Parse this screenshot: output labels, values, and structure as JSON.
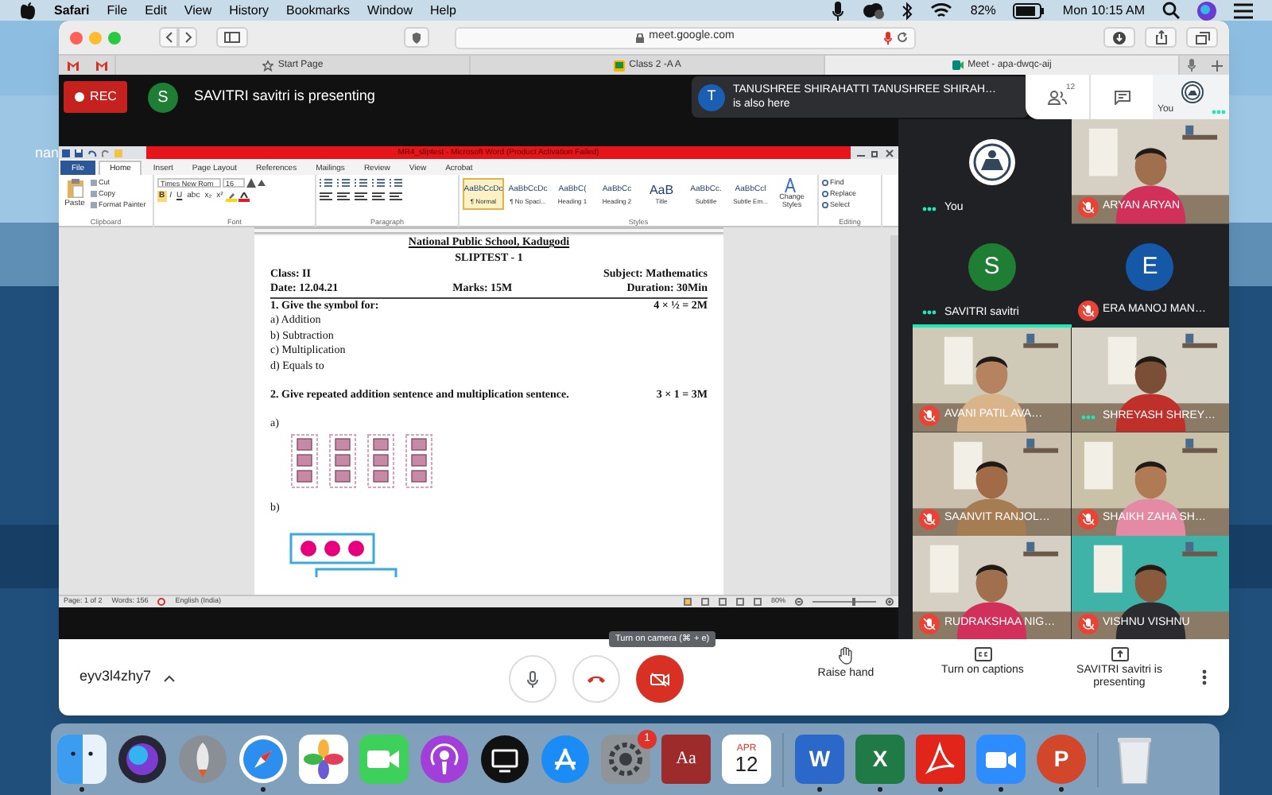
{
  "menubar": {
    "app": "Safari",
    "menus": [
      "File",
      "Edit",
      "View",
      "History",
      "Bookmarks",
      "Window",
      "Help"
    ],
    "battery": "82%",
    "clock": "Mon 10:15 AM"
  },
  "desktop_label": "nan",
  "browser": {
    "address": "meet.google.com",
    "tabs": [
      {
        "label": "Start Page",
        "kind": "start",
        "selected": false
      },
      {
        "label": "Class 2 -A A",
        "kind": "classroom",
        "selected": false
      },
      {
        "label": "Meet - apa-dwqc-aij",
        "kind": "meet",
        "selected": true
      }
    ]
  },
  "meet": {
    "rec": "REC",
    "presenter": {
      "initial": "S",
      "color": "#1e7e34",
      "text": "SAVITRI savitri is presenting"
    },
    "notice": {
      "initial": "T",
      "color": "#1a5fb4",
      "name": "TANUSHREE SHIRAHATTI TANUSHREE SHIRAH…",
      "text": "is also here"
    },
    "people_count": "12",
    "self_label": "You",
    "word": {
      "title": "MR4_sliptest - Microsoft Word (Product Activation Failed)",
      "tabs": [
        {
          "label": "File",
          "kind": "file",
          "selected": false
        },
        {
          "label": "Home",
          "kind": "tab",
          "selected": true
        },
        {
          "label": "Insert",
          "kind": "tab",
          "selected": false
        },
        {
          "label": "Page Layout",
          "kind": "tab",
          "selected": false
        },
        {
          "label": "References",
          "kind": "tab",
          "selected": false
        },
        {
          "label": "Mailings",
          "kind": "tab",
          "selected": false
        },
        {
          "label": "Review",
          "kind": "tab",
          "selected": false
        },
        {
          "label": "View",
          "kind": "tab",
          "selected": false
        },
        {
          "label": "Acrobat",
          "kind": "tab",
          "selected": false
        }
      ],
      "paste": "Paste",
      "clipboard": [
        "Cut",
        "Copy",
        "Format Painter"
      ],
      "font_name": "Times New Rom",
      "font_size": "16",
      "font_buttons": [
        "B",
        "I",
        "U",
        "abc",
        "x₂",
        "x²"
      ],
      "styles": [
        {
          "sample": "AaBbCcDc",
          "label": "¶ Normal",
          "selected": true
        },
        {
          "sample": "AaBbCcDc",
          "label": "¶ No Spaci...",
          "selected": false
        },
        {
          "sample": "AaBbC(",
          "label": "Heading 1",
          "selected": false
        },
        {
          "sample": "AaBbCc",
          "label": "Heading 2",
          "selected": false
        },
        {
          "sample": "AaB",
          "label": "Title",
          "selected": false
        },
        {
          "sample": "AaBbCc.",
          "label": "Subtitle",
          "selected": false
        },
        {
          "sample": "AaBbCcl",
          "label": "Subtle Em...",
          "selected": false
        }
      ],
      "change_styles": "Change Styles",
      "editing": [
        "Find",
        "Replace",
        "Select"
      ],
      "groups": [
        "Clipboard",
        "Font",
        "Paragraph",
        "Styles",
        "Editing"
      ],
      "document": {
        "school": "National Public School, Kadugodi",
        "title": "SLIPTEST - 1",
        "header": [
          {
            "left": "Class: II",
            "right": "Subject: Mathematics"
          },
          {
            "left": "Date: 12.04.21",
            "middle": "Marks: 15M",
            "right": "Duration: 30Min"
          }
        ],
        "questions": [
          {
            "text": "1. Give the symbol for:",
            "marks": "4 × ½ = 2M",
            "options": [
              "a) Addition",
              "b) Subtraction",
              "c) Multiplication",
              "d) Equals to"
            ]
          },
          {
            "text": "2. Give repeated addition sentence and multiplication sentence.",
            "marks": "3 × 1 = 3M",
            "parts": [
              {
                "label": "a)",
                "kind": "squares"
              },
              {
                "label": "b)",
                "kind": "circles"
              }
            ]
          }
        ]
      },
      "status": {
        "page": "Page: 1 of 2",
        "words": "Words: 156",
        "language": "English (India)",
        "zoom": "80%",
        "zoom_slider": {
          "level": 0.65
        }
      }
    },
    "participants": [
      {
        "name": "You",
        "kind": "logo",
        "muted": false,
        "speaking": true,
        "active": false
      },
      {
        "name": "ARYAN ARYAN",
        "kind": "video",
        "muted": true,
        "speaking": false,
        "active": false
      },
      {
        "name": "SAVITRI savitri",
        "kind": "avatar",
        "initial": "S",
        "color": "#1e7e34",
        "muted": false,
        "speaking": true,
        "active": true
      },
      {
        "name": "ERA MANOJ MAN…",
        "kind": "avatar",
        "initial": "E",
        "color": "#1558a8",
        "muted": true,
        "speaking": false,
        "active": false
      },
      {
        "name": "AVANI PATIL AVA…",
        "kind": "video",
        "muted": true,
        "speaking": false,
        "active": false
      },
      {
        "name": "SHREYASH SHREY…",
        "kind": "video",
        "muted": false,
        "speaking": true,
        "active": false
      },
      {
        "name": "SAANVIT RANJOL…",
        "kind": "video",
        "muted": true,
        "speaking": false,
        "active": false
      },
      {
        "name": "SHAIKH ZAHA SH…",
        "kind": "video",
        "muted": true,
        "speaking": false,
        "active": false
      },
      {
        "name": "RUDRAKSHAA NIG…",
        "kind": "video",
        "muted": true,
        "speaking": false,
        "active": false
      },
      {
        "name": "VISHNU VISHNU",
        "kind": "video",
        "muted": true,
        "speaking": false,
        "active": false
      }
    ],
    "meeting_code": "eyv3l4zhy7",
    "tooltip": "Turn on camera (⌘ + e)",
    "mic_on": true,
    "camera_on": false,
    "actions": [
      {
        "label": "Raise hand",
        "kind": "hand"
      },
      {
        "label": "Turn on captions",
        "kind": "captions"
      },
      {
        "label": "SAVITRI savitri is presenting",
        "kind": "present"
      }
    ]
  },
  "dock": [
    {
      "kind": "finder",
      "running": true
    },
    {
      "kind": "siri",
      "running": false
    },
    {
      "kind": "launchpad",
      "running": false
    },
    {
      "kind": "safari",
      "running": true
    },
    {
      "kind": "photos",
      "running": false
    },
    {
      "kind": "facetime",
      "running": false
    },
    {
      "kind": "podcasts",
      "running": false
    },
    {
      "kind": "tv",
      "running": false
    },
    {
      "kind": "appstore",
      "running": false
    },
    {
      "kind": "settings",
      "running": false,
      "badge": "1"
    },
    {
      "kind": "dictionary",
      "running": false,
      "text": "Aa"
    },
    {
      "kind": "calendar",
      "running": false,
      "month": "APR",
      "day": "12"
    },
    {
      "kind": "separator"
    },
    {
      "kind": "word",
      "running": true,
      "text": "W"
    },
    {
      "kind": "excel",
      "running": true,
      "text": "X"
    },
    {
      "kind": "acrobat",
      "running": true
    },
    {
      "kind": "zoom",
      "running": true
    },
    {
      "kind": "powerpoint",
      "running": true,
      "text": "P"
    },
    {
      "kind": "separator"
    },
    {
      "kind": "trash",
      "running": false
    }
  ]
}
